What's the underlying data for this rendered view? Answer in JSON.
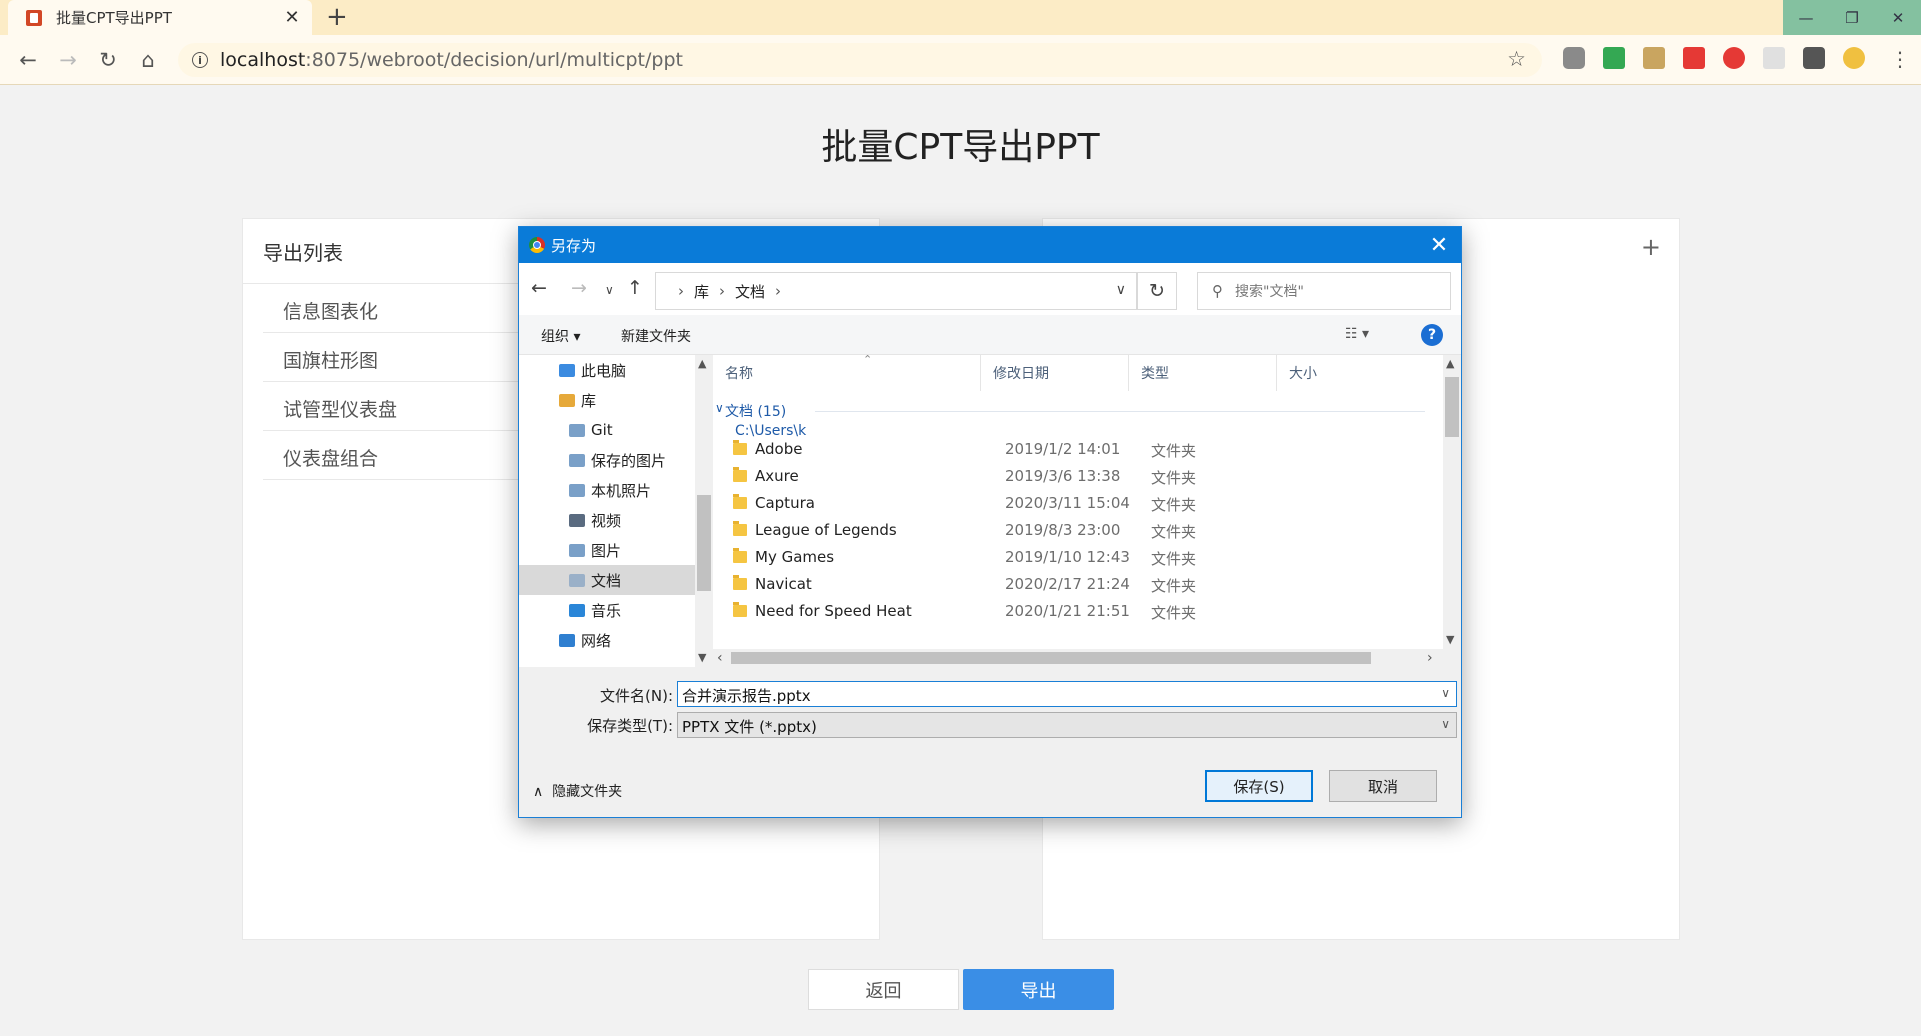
{
  "browser": {
    "tab_title": "批量CPT导出PPT",
    "url_host": "localhost",
    "url_path": ":8075/webroot/decision/url/multicpt/ppt",
    "window_buttons": [
      "—",
      "❐",
      "✕"
    ]
  },
  "page": {
    "title": "批量CPT导出PPT",
    "left_panel": {
      "header": "导出列表",
      "items": [
        "信息图表化",
        "国旗柱形图",
        "试管型仪表盘",
        "仪表盘组合"
      ]
    },
    "right_panel": {
      "add_label": "+"
    },
    "back_label": "返回",
    "export_label": "导出"
  },
  "dialog": {
    "title": "另存为",
    "breadcrumb": [
      "库",
      "文档"
    ],
    "search_placeholder": "搜索\"文档\"",
    "toolbar": {
      "organize": "组织 ▾",
      "new_folder": "新建文件夹",
      "help": "?"
    },
    "tree": [
      {
        "label": "此电脑",
        "indent": 1,
        "color": "#3b8be0"
      },
      {
        "label": "库",
        "indent": 1,
        "color": "#e6a93a"
      },
      {
        "label": "Git",
        "indent": 2,
        "color": "#7aa0c8"
      },
      {
        "label": "保存的图片",
        "indent": 2,
        "color": "#7aa0c8"
      },
      {
        "label": "本机照片",
        "indent": 2,
        "color": "#7aa0c8"
      },
      {
        "label": "视频",
        "indent": 2,
        "color": "#5a6b80"
      },
      {
        "label": "图片",
        "indent": 2,
        "color": "#7aa0c8"
      },
      {
        "label": "文档",
        "indent": 2,
        "color": "#9ab0c8",
        "selected": true
      },
      {
        "label": "音乐",
        "indent": 2,
        "color": "#2a86d8"
      },
      {
        "label": "网络",
        "indent": 1,
        "color": "#2f7fd0"
      }
    ],
    "columns": {
      "name": "名称",
      "date": "修改日期",
      "type": "类型",
      "size": "大小"
    },
    "group": {
      "title": "文档 (15)",
      "path": "C:\\Users\\k"
    },
    "files": [
      {
        "name": "Adobe",
        "date": "2019/1/2 14:01",
        "type": "文件夹"
      },
      {
        "name": "Axure",
        "date": "2019/3/6 13:38",
        "type": "文件夹"
      },
      {
        "name": "Captura",
        "date": "2020/3/11 15:04",
        "type": "文件夹"
      },
      {
        "name": "League of Legends",
        "date": "2019/8/3 23:00",
        "type": "文件夹"
      },
      {
        "name": "My Games",
        "date": "2019/1/10 12:43",
        "type": "文件夹"
      },
      {
        "name": "Navicat",
        "date": "2020/2/17 21:24",
        "type": "文件夹"
      },
      {
        "name": "Need for Speed Heat",
        "date": "2020/1/21 21:51",
        "type": "文件夹"
      }
    ],
    "filename_label": "文件名(N):",
    "filename_value": "合并演示报告.pptx",
    "filetype_label": "保存类型(T):",
    "filetype_value": "PPTX 文件 (*.pptx)",
    "hide_folders": "隐藏文件夹",
    "save_label": "保存(S)",
    "cancel_label": "取消"
  }
}
